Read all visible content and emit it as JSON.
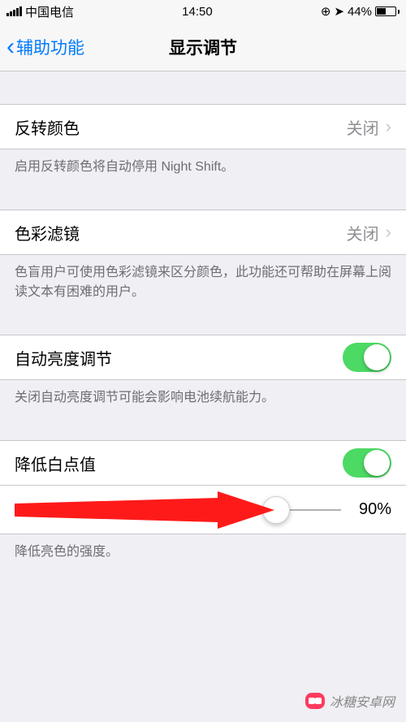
{
  "status": {
    "carrier": "中国电信",
    "time": "14:50",
    "battery_pct": "44%"
  },
  "nav": {
    "back": "辅助功能",
    "title": "显示调节"
  },
  "rows": {
    "invert": {
      "label": "反转颜色",
      "value": "关闭"
    },
    "invert_footer": "启用反转颜色将自动停用 Night Shift。",
    "color_filter": {
      "label": "色彩滤镜",
      "value": "关闭"
    },
    "color_filter_footer": "色盲用户可使用色彩滤镜来区分颜色，此功能还可帮助在屏幕上阅读文本有困难的用户。",
    "auto_brightness": {
      "label": "自动亮度调节"
    },
    "auto_brightness_footer": "关闭自动亮度调节可能会影响电池续航能力。",
    "reduce_white": {
      "label": "降低白点值"
    },
    "reduce_white_value": "90%",
    "reduce_white_footer": "降低亮色的强度。"
  },
  "watermark": "冰糖安卓网"
}
